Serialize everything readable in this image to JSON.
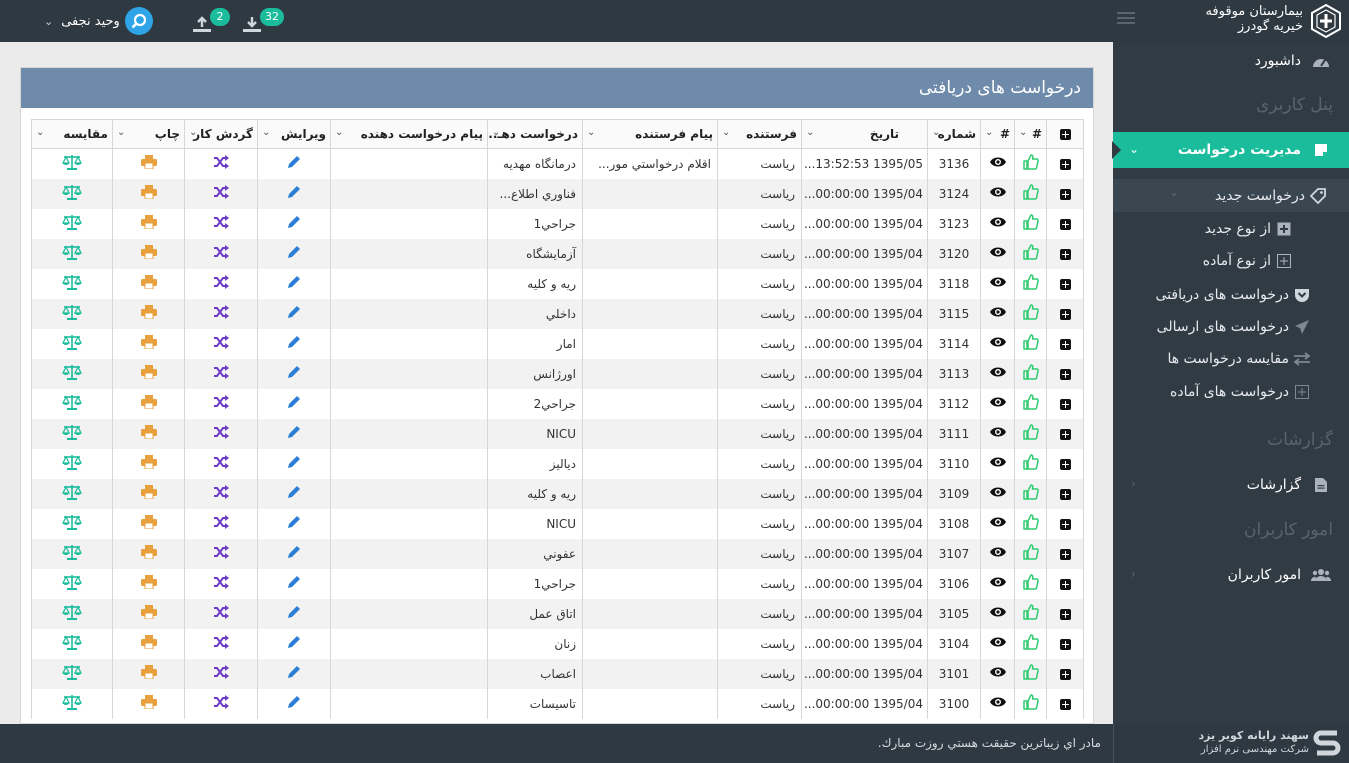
{
  "app": {
    "logo_line1": "بیمارستان موقوفه",
    "logo_line2": "خیریه گودرز"
  },
  "topbar": {
    "user_name": "وحید نجفی",
    "upload_count": "2",
    "download_count": "32"
  },
  "sidebar": {
    "dashboard": "داشبورد",
    "user_panel_header": "پنل کاربری",
    "request_management": "مدیریت درخواست",
    "new_request": "درخواست جدید",
    "from_new_type": "از نوع جدید",
    "from_ready_type": "از نوع آماده",
    "received_requests": "درخواست های دریافتی",
    "sent_requests": "درخواست های ارسالی",
    "compare_requests": "مقایسه درخواست ها",
    "ready_requests": "درخواست های آماده",
    "reports_header": "گزارشات",
    "reports": "گزارشات",
    "users_header": "امور کاربران",
    "users": "امور کاربران"
  },
  "panel": {
    "title": "درخواست های دریافتی"
  },
  "table": {
    "headers": {
      "hash": "#",
      "number": "شماره",
      "date": "تاریخ",
      "sender": "فرستنده",
      "sender_msg": "پیام فرستنده",
      "requester": "درخواست دهـ..",
      "requester_msg": "پیام درخواست دهنده",
      "edit": "ویرایش",
      "workflow": "گردش کار",
      "print": "چاپ",
      "compare": "مقایسه"
    },
    "rows": [
      {
        "num": "3136",
        "date": "1395/05 13:52:53...",
        "sender": "رياست",
        "sender_msg": "اقلام درخواستي مور...",
        "requester": "درمانگاه مهديه"
      },
      {
        "num": "3124",
        "date": "1395/04 00:00:00...",
        "sender": "رياست",
        "sender_msg": "",
        "requester": "فناوري اطلاع..."
      },
      {
        "num": "3123",
        "date": "1395/04 00:00:00...",
        "sender": "رياست",
        "sender_msg": "",
        "requester": "جراحي1"
      },
      {
        "num": "3120",
        "date": "1395/04 00:00:00...",
        "sender": "رياست",
        "sender_msg": "",
        "requester": "آزمايشگاه"
      },
      {
        "num": "3118",
        "date": "1395/04 00:00:00...",
        "sender": "رياست",
        "sender_msg": "",
        "requester": "ريه و كليه"
      },
      {
        "num": "3115",
        "date": "1395/04 00:00:00...",
        "sender": "رياست",
        "sender_msg": "",
        "requester": "داخلي"
      },
      {
        "num": "3114",
        "date": "1395/04 00:00:00...",
        "sender": "رياست",
        "sender_msg": "",
        "requester": "امار"
      },
      {
        "num": "3113",
        "date": "1395/04 00:00:00...",
        "sender": "رياست",
        "sender_msg": "",
        "requester": "اورژانس"
      },
      {
        "num": "3112",
        "date": "1395/04 00:00:00...",
        "sender": "رياست",
        "sender_msg": "",
        "requester": "جراحي2"
      },
      {
        "num": "3111",
        "date": "1395/04 00:00:00...",
        "sender": "رياست",
        "sender_msg": "",
        "requester": "NICU"
      },
      {
        "num": "3110",
        "date": "1395/04 00:00:00...",
        "sender": "رياست",
        "sender_msg": "",
        "requester": "دياليز"
      },
      {
        "num": "3109",
        "date": "1395/04 00:00:00...",
        "sender": "رياست",
        "sender_msg": "",
        "requester": "ريه و كليه"
      },
      {
        "num": "3108",
        "date": "1395/04 00:00:00...",
        "sender": "رياست",
        "sender_msg": "",
        "requester": "NICU"
      },
      {
        "num": "3107",
        "date": "1395/04 00:00:00...",
        "sender": "رياست",
        "sender_msg": "",
        "requester": "عفوني"
      },
      {
        "num": "3106",
        "date": "1395/04 00:00:00...",
        "sender": "رياست",
        "sender_msg": "",
        "requester": "جراحي1"
      },
      {
        "num": "3105",
        "date": "1395/04 00:00:00...",
        "sender": "رياست",
        "sender_msg": "",
        "requester": "اتاق عمل"
      },
      {
        "num": "3104",
        "date": "1395/04 00:00:00...",
        "sender": "رياست",
        "sender_msg": "",
        "requester": "زنان"
      },
      {
        "num": "3101",
        "date": "1395/04 00:00:00...",
        "sender": "رياست",
        "sender_msg": "",
        "requester": "اعصاب"
      },
      {
        "num": "3100",
        "date": "1395/04 00:00:00...",
        "sender": "رياست",
        "sender_msg": "",
        "requester": "تاسيسات"
      }
    ]
  },
  "footer": {
    "message": "مادر اي زيباترين حقيقت هستي روزت مبارك.",
    "company_line1": "سهند رایانه کویر یزد",
    "company_line2": "شرکت مهندسی نرم افزار"
  },
  "colors": {
    "accent": "#1abc9c",
    "topbar": "#2f3942",
    "sidebar": "#313b44",
    "panel_header": "#6f8bab",
    "icon_green": "#2ecc71",
    "icon_blue": "#2a7fd4",
    "icon_orange": "#e8a03c",
    "icon_purple": "#6c3bc6",
    "icon_teal": "#1abc9c"
  }
}
